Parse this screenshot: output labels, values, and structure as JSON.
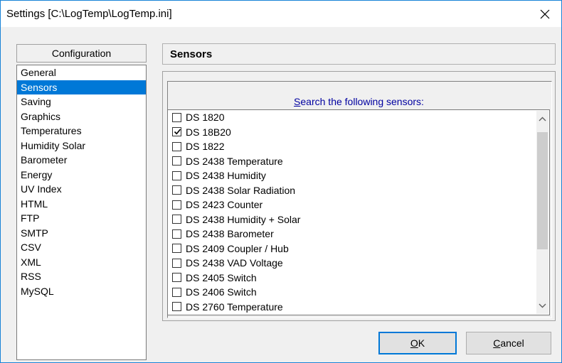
{
  "window": {
    "title": "Settings [C:\\LogTemp\\LogTemp.ini]"
  },
  "config": {
    "header": "Configuration",
    "items": [
      {
        "label": "General"
      },
      {
        "label": "Sensors",
        "selected": true
      },
      {
        "label": "Saving"
      },
      {
        "label": "Graphics"
      },
      {
        "label": "Temperatures"
      },
      {
        "label": "Humidity  Solar"
      },
      {
        "label": "Barometer"
      },
      {
        "label": "Energy"
      },
      {
        "label": "UV Index"
      },
      {
        "label": "HTML"
      },
      {
        "label": "FTP"
      },
      {
        "label": "SMTP"
      },
      {
        "label": "CSV"
      },
      {
        "label": "XML"
      },
      {
        "label": "RSS"
      },
      {
        "label": "MySQL"
      }
    ]
  },
  "sensors": {
    "header": "Sensors",
    "search_label_first": "S",
    "search_label_rest": "earch the following sensors:",
    "items": [
      {
        "label": "DS 1820",
        "checked": false
      },
      {
        "label": "DS 18B20",
        "checked": true
      },
      {
        "label": "DS 1822",
        "checked": false
      },
      {
        "label": "DS 2438 Temperature",
        "checked": false
      },
      {
        "label": "DS 2438 Humidity",
        "checked": false
      },
      {
        "label": "DS 2438 Solar Radiation",
        "checked": false
      },
      {
        "label": "DS 2423 Counter",
        "checked": false
      },
      {
        "label": "DS 2438 Humidity + Solar",
        "checked": false
      },
      {
        "label": "DS 2438 Barometer",
        "checked": false
      },
      {
        "label": "DS 2409 Coupler / Hub",
        "checked": false
      },
      {
        "label": "DS 2438 VAD Voltage",
        "checked": false
      },
      {
        "label": "DS 2405 Switch",
        "checked": false
      },
      {
        "label": "DS 2406 Switch",
        "checked": false
      },
      {
        "label": "DS 2760 Temperature",
        "checked": false
      }
    ]
  },
  "buttons": {
    "ok_first": "O",
    "ok_rest": "K",
    "cancel_first": "C",
    "cancel_rest": "ancel"
  },
  "colors": {
    "selection": "#0078d7",
    "search_label": "#0000a0"
  }
}
